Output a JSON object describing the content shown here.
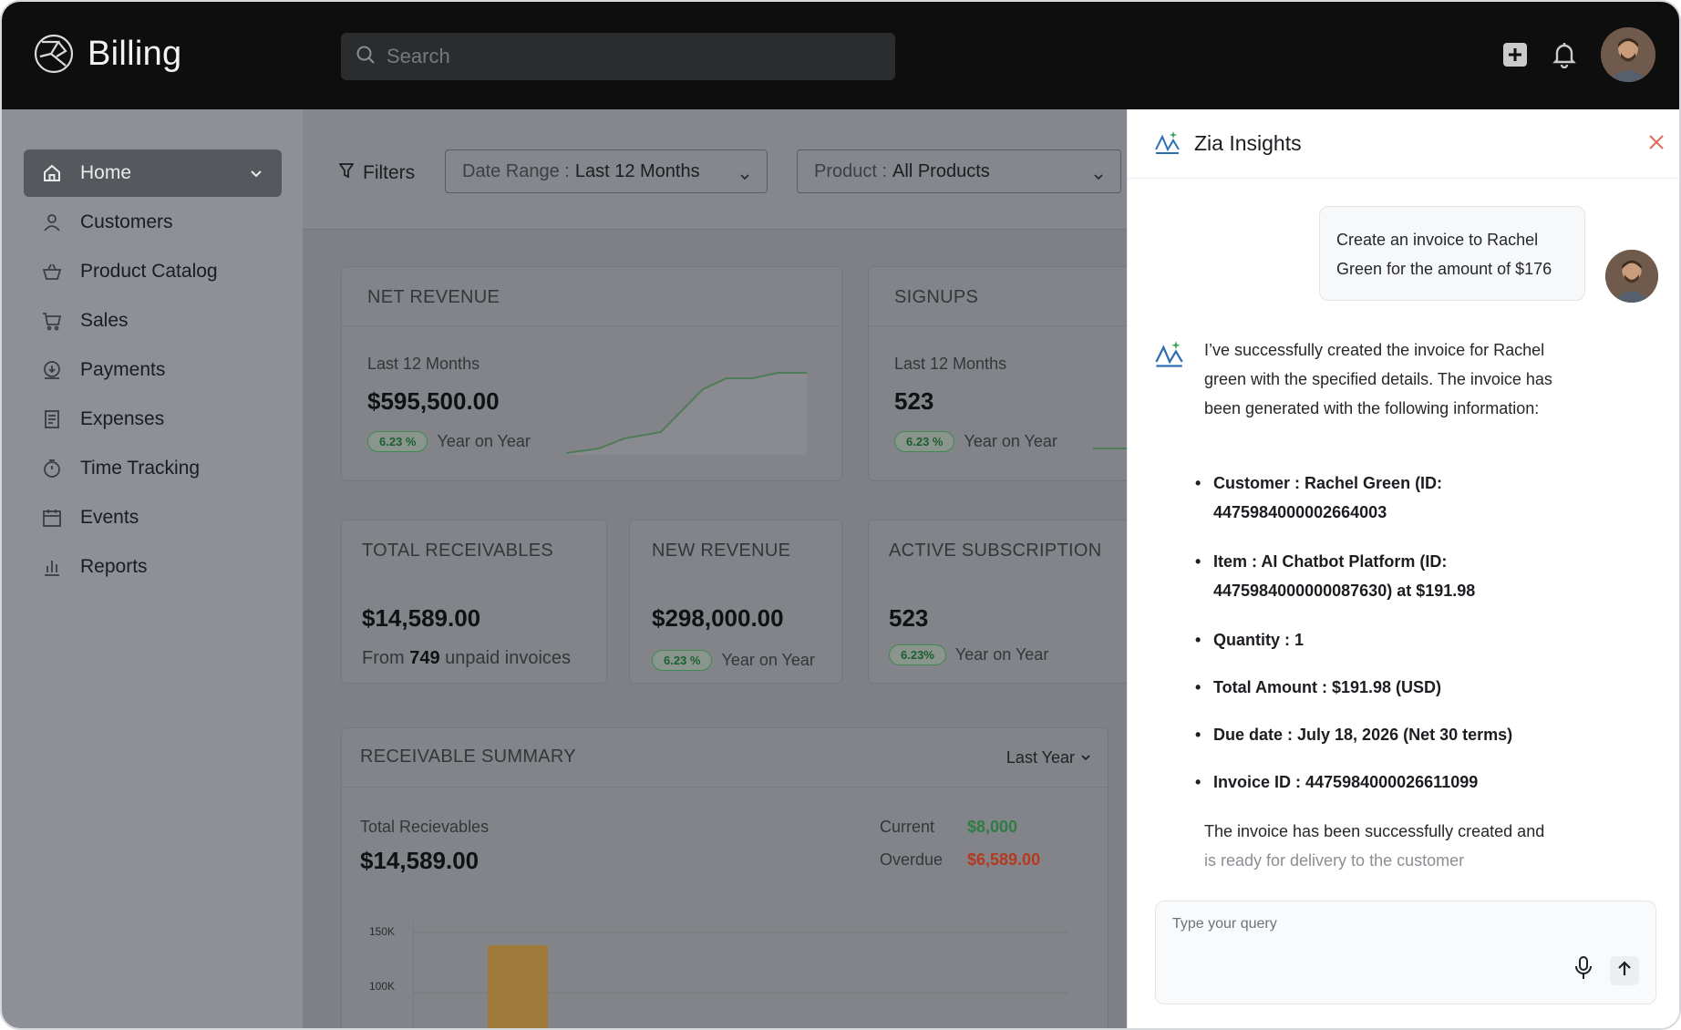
{
  "app": {
    "name": "Billing"
  },
  "search": {
    "placeholder": "Search"
  },
  "header": {
    "icons": [
      "plus-square-icon",
      "bell-icon"
    ],
    "avatar": "user-avatar"
  },
  "sidebar": {
    "items": [
      {
        "label": "Home",
        "icon": "home-icon",
        "active": true
      },
      {
        "label": "Customers",
        "icon": "user-icon"
      },
      {
        "label": "Product Catalog",
        "icon": "basket-icon"
      },
      {
        "label": "Sales",
        "icon": "cart-icon"
      },
      {
        "label": "Payments",
        "icon": "payment-icon"
      },
      {
        "label": "Expenses",
        "icon": "receipt-icon"
      },
      {
        "label": "Time Tracking",
        "icon": "stopwatch-icon"
      },
      {
        "label": "Events",
        "icon": "calendar-icon"
      },
      {
        "label": "Reports",
        "icon": "bar-chart-icon"
      }
    ]
  },
  "filters": {
    "label": "Filters",
    "date_range": {
      "label": "Date Range :",
      "value": "Last 12 Months"
    },
    "product": {
      "label": "Product :",
      "value": "All Products"
    }
  },
  "cards": {
    "net_revenue": {
      "title": "NET REVENUE",
      "period": "Last 12 Months",
      "value": "$595,500.00",
      "change": "6.23 %",
      "change_label": "Year on Year"
    },
    "signups": {
      "title": "SIGNUPS",
      "period": "Last 12 Months",
      "value": "523",
      "change": "6.23 %",
      "change_label": "Year on Year"
    },
    "total_receivables": {
      "title": "TOTAL RECEIVABLES",
      "value": "$14,589.00",
      "from": "From",
      "count": "749",
      "suffix": "unpaid invoices"
    },
    "new_revenue": {
      "title": "NEW REVENUE",
      "value": "$298,000.00",
      "change": "6.23 %",
      "change_label": "Year on Year"
    },
    "active_subscription": {
      "title": "ACTIVE SUBSCRIPTION",
      "value": "523",
      "change": "6.23%",
      "change_label": "Year on Year"
    }
  },
  "receivable_summary": {
    "title": "RECEIVABLE SUMMARY",
    "period": "Last Year",
    "total_label": "Total Recievables",
    "total_value": "$14,589.00",
    "current_label": "Current",
    "current_value": "$8,000",
    "overdue_label": "Overdue",
    "overdue_value": "$6,589.00",
    "y_ticks": [
      "150K",
      "100K"
    ]
  },
  "zia": {
    "title": "Zia Insights",
    "user_message": "Create an invoice to Rachel Green for the amount of $176",
    "reply_intro": "I’ve successfully created the invoice for Rachel green with the specified details. The invoice has been generated with the following information:",
    "bullets": [
      "Customer :  Rachel Green (ID: 4475984000002664003",
      "Item :  AI Chatbot Platform (ID: 4475984000000087630) at $191.98",
      "Quantity : 1",
      "Total Amount : $191.98 (USD)",
      "Due date : July 18, 2026 (Net 30 terms)",
      "Invoice ID : 4475984000026611099"
    ],
    "closing_main": "The invoice has been successfully created and",
    "closing_fade": "is ready for delivery to the customer",
    "query_placeholder": "Type your query"
  },
  "colors": {
    "header_bg": "#0e0e0f",
    "positive": "#2f7d44",
    "negative": "#b5381f",
    "bar": "#a07a3a"
  }
}
